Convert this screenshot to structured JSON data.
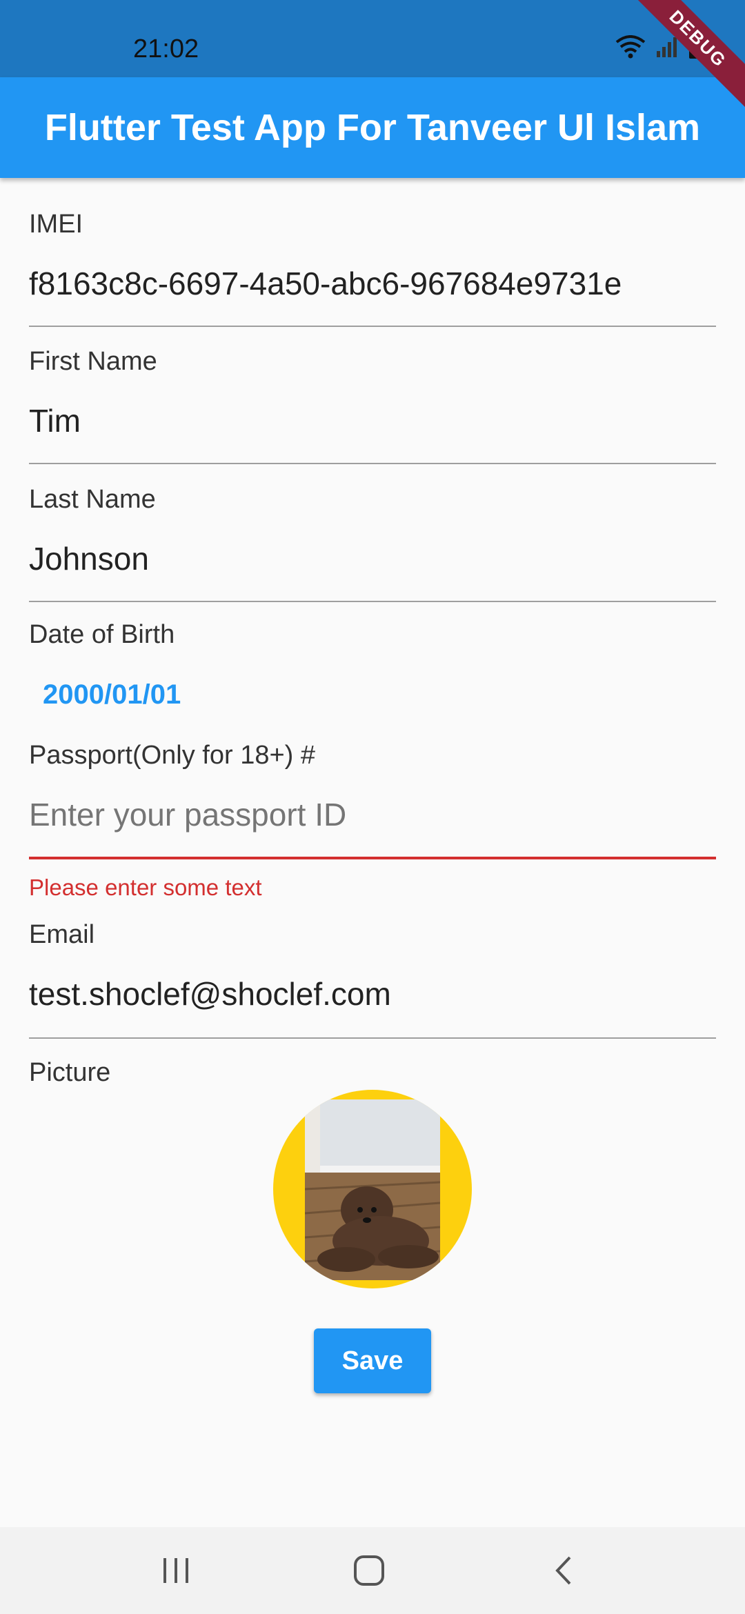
{
  "status_bar": {
    "time": "21:02",
    "debug_label": "DEBUG"
  },
  "app_bar": {
    "title": "Flutter Test App For Tanveer Ul Islam"
  },
  "form": {
    "imei": {
      "label": "IMEI",
      "value": "f8163c8c-6697-4a50-abc6-967684e9731e"
    },
    "first_name": {
      "label": "First Name",
      "value": "Tim"
    },
    "last_name": {
      "label": "Last Name",
      "value": "Johnson"
    },
    "dob": {
      "label": "Date of Birth",
      "value": "2000/01/01"
    },
    "passport": {
      "label": "Passport(Only for 18+) #",
      "placeholder": "Enter your passport ID",
      "error": "Please enter some text"
    },
    "email": {
      "label": "Email",
      "value": "test.shoclef@shoclef.com"
    },
    "picture": {
      "label": "Picture"
    },
    "save_label": "Save"
  },
  "colors": {
    "primary": "#2196f3",
    "status_bar": "#1e77c0",
    "error": "#d32f2f",
    "avatar_ring": "#fdd00e"
  },
  "icons": {
    "status": [
      "wifi-icon",
      "signal-icon",
      "battery-icon"
    ],
    "nav": [
      "recents-icon",
      "home-icon",
      "back-icon"
    ]
  }
}
